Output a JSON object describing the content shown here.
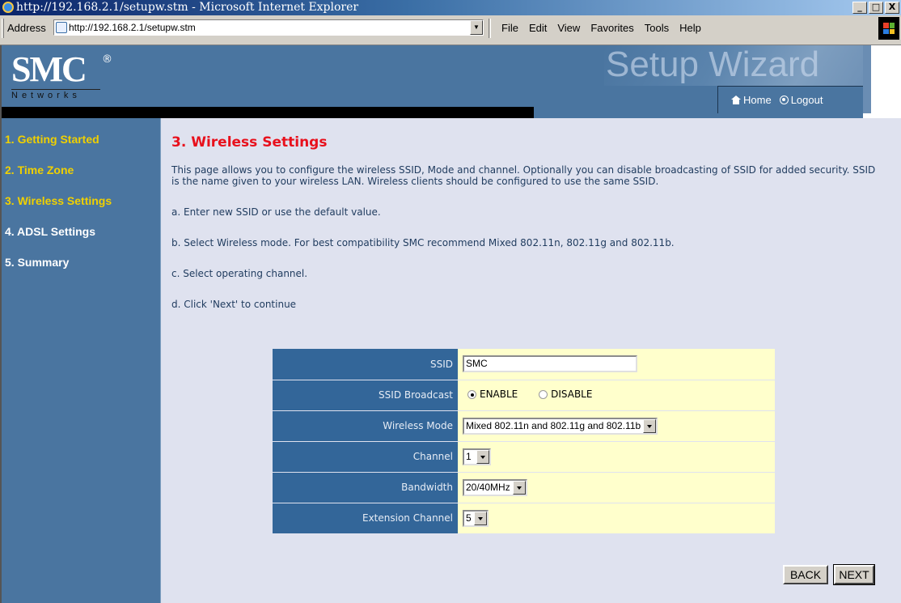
{
  "window": {
    "title": "http://192.168.2.1/setupw.stm - Microsoft Internet Explorer",
    "controls": [
      "_",
      "□",
      "X"
    ]
  },
  "toolbar": {
    "address_label": "Address",
    "address_value": "http://192.168.2.1/setupw.stm",
    "menu": [
      "File",
      "Edit",
      "View",
      "Favorites",
      "Tools",
      "Help"
    ]
  },
  "header": {
    "logo_text": "SMC",
    "logo_registered": "®",
    "logo_sub": "Networks",
    "banner": "Setup Wizard",
    "nav_home": "Home",
    "nav_logout": "Logout"
  },
  "sidebar": {
    "items": [
      {
        "label": "1. Getting Started",
        "color": "#f0d000"
      },
      {
        "label": "2. Time Zone",
        "color": "#f0d000"
      },
      {
        "label": "3. Wireless Settings",
        "color": "#f0d000"
      },
      {
        "label": "4. ADSL Settings",
        "color": "#ffffff"
      },
      {
        "label": "5. Summary",
        "color": "#ffffff"
      }
    ]
  },
  "main": {
    "heading": "3. Wireless Settings",
    "intro": "This page allows you to configure the wireless SSID, Mode and channel. Optionally you can disable broadcasting of SSID for added security. SSID is the name given to your wireless LAN. Wireless clients should be configured to use the same SSID.",
    "steps": [
      "a. Enter new SSID or use the default value.",
      "b. Select Wireless mode. For best compatibility SMC recommend Mixed 802.11n, 802.11g and 802.11b.",
      "c. Select operating channel.",
      "d. Click 'Next' to continue"
    ]
  },
  "form": {
    "ssid": {
      "label": "SSID",
      "value": "SMC"
    },
    "broadcast": {
      "label": "SSID Broadcast",
      "options": [
        "ENABLE",
        "DISABLE"
      ],
      "selected": "ENABLE"
    },
    "mode": {
      "label": "Wireless Mode",
      "value": "Mixed 802.11n and 802.11g and 802.11b"
    },
    "channel": {
      "label": "Channel",
      "value": "1"
    },
    "bandwidth": {
      "label": "Bandwidth",
      "value": "20/40MHz"
    },
    "extension": {
      "label": "Extension Channel",
      "value": "5"
    }
  },
  "buttons": {
    "back": "BACK",
    "next": "NEXT"
  }
}
